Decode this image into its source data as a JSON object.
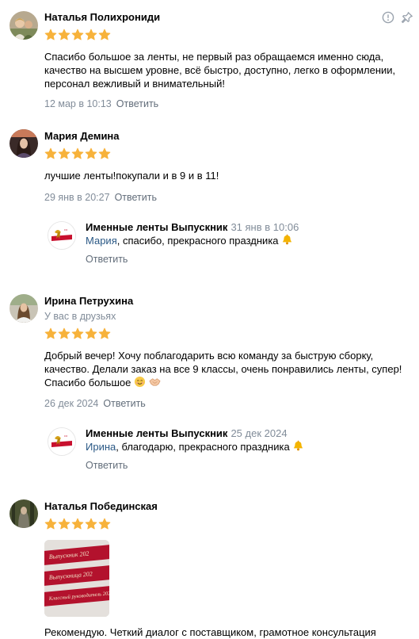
{
  "icons": {
    "report": "info-circle-icon",
    "pin": "pin-icon",
    "star": "star-icon"
  },
  "colors": {
    "star": "#f7b23b",
    "link": "#2a5885",
    "muted": "#818c99",
    "action": "#626d7a",
    "brand_red": "#c8102e"
  },
  "reviews": [
    {
      "author": "Наталья Полихрониди",
      "rating": 5,
      "text": "Спасибо большое за ленты, не первый раз обращаемся именно сюда, качество на высшем уровне, всё быстро, доступно, легко в оформлении, персонал вежливый и внимательный!",
      "date": "12 мар в 10:13",
      "reply_label": "Ответить"
    },
    {
      "author": "Мария Демина",
      "rating": 5,
      "text": "лучшие ленты!покупали и в 9 и в 11!",
      "date": "29 янв в 20:27",
      "reply_label": "Ответить",
      "answer": {
        "author": "Именные ленты Выпускник",
        "date": "31 янв в 10:06",
        "mention": "Мария",
        "text": ", спасибо, прекрасного праздника",
        "emoji": "bell-emoji",
        "reply_label": "Ответить"
      }
    },
    {
      "author": "Ирина Петрухина",
      "subtitle": "У вас в друзьях",
      "rating": 5,
      "text": "Добрый вечер! Хочу поблагодарить всю команду за быструю сборку, качество. Делали заказ на все 9 классы, очень понравились ленты, супер! Спасибо большое",
      "emojis": [
        "smiling-face-emoji",
        "handshake-emoji"
      ],
      "date": "26 дек 2024",
      "reply_label": "Ответить",
      "answer": {
        "author": "Именные ленты Выпускник",
        "date": "25 дек 2024",
        "mention": "Ирина",
        "text": ", благодарю, прекрасного праздника",
        "emoji": "bell-emoji",
        "reply_label": "Ответить"
      }
    },
    {
      "author": "Наталья Побединская",
      "rating": 5,
      "photo_ribbon_texts": [
        "Выпускник 202",
        "Выпускница 202",
        "Классный руководитель 202"
      ],
      "text": "Рекомендую. Четкий диалог с поставщиком, грамотное консультация"
    }
  ]
}
